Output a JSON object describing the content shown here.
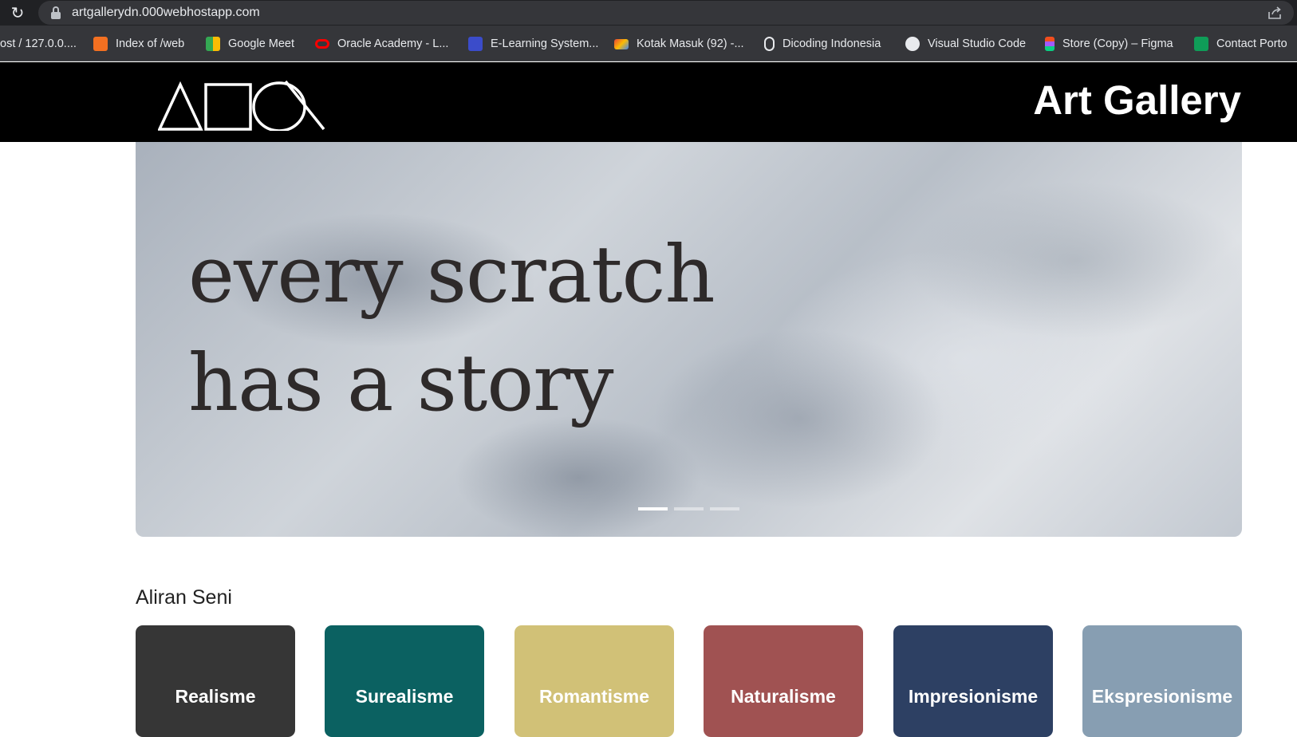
{
  "browser": {
    "url": "artgallerydn.000webhostapp.com",
    "bookmarks": [
      {
        "label": "ost / 127.0.0....",
        "icon": "none",
        "color": ""
      },
      {
        "label": "Index of /web",
        "icon": "xampp-icon",
        "color": "#f37021"
      },
      {
        "label": "Google Meet",
        "icon": "google-meet-icon",
        "color": "#34a853"
      },
      {
        "label": "Oracle Academy - L...",
        "icon": "oracle-icon",
        "color": "#f80000"
      },
      {
        "label": "E-Learning System...",
        "icon": "elearning-icon",
        "color": "#3b4cca"
      },
      {
        "label": "Kotak Masuk (92) -...",
        "icon": "gmail-icon",
        "color": "#ea4335"
      },
      {
        "label": "Dicoding Indonesia",
        "icon": "dicoding-icon",
        "color": "#ffffff"
      },
      {
        "label": "Visual Studio Code",
        "icon": "globe-icon",
        "color": "#ffffff"
      },
      {
        "label": "Store (Copy) – Figma",
        "icon": "figma-icon",
        "color": "#f24e1e"
      },
      {
        "label": "Contact Porto",
        "icon": "google-sheets-icon",
        "color": "#0f9d58"
      }
    ]
  },
  "site": {
    "title": "Art Gallery"
  },
  "hero": {
    "line1": "every scratch",
    "line2": "has a story",
    "slides_total": 3,
    "active_slide": 1
  },
  "section": {
    "title": "Aliran Seni"
  },
  "categories": [
    {
      "label": "Realisme",
      "color": "#363636"
    },
    {
      "label": "Surealisme",
      "color": "#0b6161"
    },
    {
      "label": "Romantisme",
      "color": "#d1c177"
    },
    {
      "label": "Naturalisme",
      "color": "#a05252"
    },
    {
      "label": "Impresionisme",
      "color": "#2d4063"
    },
    {
      "label": "Ekspresionisme",
      "color": "#879eb2"
    }
  ]
}
